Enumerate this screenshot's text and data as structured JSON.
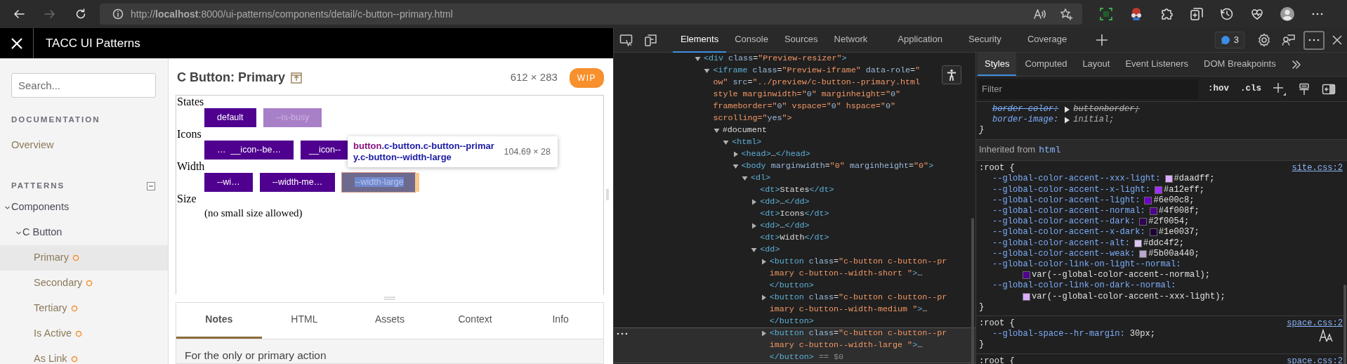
{
  "browser": {
    "url": "http://**localhost**:8000/ui-patterns/components/detail/c-button--primary.html",
    "back_disabled": false,
    "forward_disabled": true
  },
  "app": {
    "title": "TACC UI Patterns"
  },
  "sidebar": {
    "search_placeholder": "Search...",
    "documentation": {
      "heading": "DOCUMENTATION",
      "items": [
        {
          "label": "Overview"
        }
      ]
    },
    "patterns": {
      "heading": "PATTERNS",
      "tree": [
        {
          "label": "Components",
          "expanded": true,
          "children": [
            {
              "label": "C Button",
              "expanded": true,
              "children": [
                {
                  "label": "Primary",
                  "selected": true,
                  "wip": true
                },
                {
                  "label": "Secondary",
                  "selected": false,
                  "wip": true
                },
                {
                  "label": "Tertiary",
                  "selected": false,
                  "wip": true
                },
                {
                  "label": "Is Active",
                  "selected": false,
                  "wip": true
                },
                {
                  "label": "As Link",
                  "selected": false,
                  "wip": true
                }
              ]
            }
          ]
        }
      ]
    }
  },
  "preview": {
    "title": "C Button: Primary",
    "size": "612 × 283",
    "status": "WIP",
    "groups": [
      {
        "term": "States",
        "buttons": [
          {
            "label": "default",
            "busy": false,
            "inspected": false
          },
          {
            "label": "--is-busy",
            "busy": true,
            "inspected": false
          }
        ]
      },
      {
        "term": "Icons",
        "buttons": [
          {
            "label": "…  __icon--be…",
            "busy": false,
            "inspected": false
          },
          {
            "label": "__icon--",
            "busy": false,
            "inspected": false
          }
        ]
      },
      {
        "term": "Width",
        "buttons": [
          {
            "label": "--wi…",
            "busy": false,
            "inspected": false
          },
          {
            "label": "--width-me…",
            "busy": false,
            "inspected": false
          },
          {
            "label": "--width-large",
            "busy": false,
            "inspected": true
          }
        ]
      },
      {
        "term": "Size",
        "note": "(no small size allowed)"
      }
    ],
    "tooltip": {
      "tag": "button",
      "classes": ".c-button.c-button--primary.c-button--width-large",
      "size": "104.69 × 28"
    }
  },
  "panel": {
    "tabs": [
      {
        "label": "Notes",
        "selected": true
      },
      {
        "label": "HTML",
        "selected": false
      },
      {
        "label": "Assets",
        "selected": false
      },
      {
        "label": "Context",
        "selected": false
      },
      {
        "label": "Info",
        "selected": false
      }
    ],
    "notes": "For the only or primary action"
  },
  "devtools": {
    "tabs": [
      {
        "label": "Elements",
        "selected": true
      },
      {
        "label": "Console",
        "selected": false
      },
      {
        "label": "Sources",
        "selected": false
      },
      {
        "label": "Network",
        "selected": false
      },
      {
        "label": "Application",
        "selected": false
      },
      {
        "label": "Security",
        "selected": false
      },
      {
        "label": "Coverage",
        "selected": false
      }
    ],
    "issues": "3",
    "dom": [
      {
        "lines": [
          "<div class=\"Preview-resizer\">"
        ],
        "expanded": true,
        "selected": false,
        "children": [
          {
            "lines": [
              "<iframe class=\"Preview-iframe\" data-role=\"",
              "ow\" src=\"../preview/c-button--primary.html",
              "style marginwidth=\"0\" marginheight=\"0\"",
              "frameborder=\"0\" vspace=\"0\" hspace=\"0\"",
              "scrolling=\"yes\">"
            ],
            "expanded": true,
            "selected": false,
            "children": [
              {
                "lines": [
                  "#document"
                ],
                "expanded": true,
                "selected": false,
                "children": [
                  {
                    "lines": [
                      "<html>"
                    ],
                    "expanded": true,
                    "selected": false,
                    "children": [
                      {
                        "lines": [
                          "<head>…</head>"
                        ],
                        "expanded": false,
                        "selected": false
                      },
                      {
                        "lines": [
                          "<body marginwidth=\"0\" marginheight=\"0\">"
                        ],
                        "expanded": true,
                        "selected": false,
                        "children": [
                          {
                            "lines": [
                              "<dl>"
                            ],
                            "expanded": true,
                            "selected": false,
                            "children": [
                              {
                                "lines": [
                                  "<dt>States</dt>"
                                ],
                                "selected": false
                              },
                              {
                                "lines": [
                                  "<dd>…</dd>"
                                ],
                                "expanded": false,
                                "selected": false
                              },
                              {
                                "lines": [
                                  "<dt>Icons</dt>"
                                ],
                                "selected": false
                              },
                              {
                                "lines": [
                                  "<dd>…</dd>"
                                ],
                                "expanded": false,
                                "selected": false
                              },
                              {
                                "lines": [
                                  "<dt>Width</dt>"
                                ],
                                "selected": false
                              },
                              {
                                "lines": [
                                  "<dd>"
                                ],
                                "expanded": true,
                                "selected": false,
                                "children": [
                                  {
                                    "lines": [
                                      "<button class=\"c-button c-button--pr",
                                      "imary c-button--width-short \">…",
                                      "</button>"
                                    ],
                                    "expanded": false,
                                    "selected": false
                                  },
                                  {
                                    "lines": [
                                      "<button class=\"c-button c-button--pr",
                                      "imary c-button--width-medium \">…",
                                      "</button>"
                                    ],
                                    "expanded": false,
                                    "selected": false
                                  },
                                  {
                                    "lines": [
                                      "<button class=\"c-button c-button--pr",
                                      "imary c-button--width-large \">…",
                                      "</button>"
                                    ],
                                    "expanded": false,
                                    "selected": true,
                                    "marker": "== $0"
                                  }
                                ]
                              }
                            ]
                          }
                        ]
                      }
                    ]
                  }
                ]
              }
            ]
          }
        ]
      }
    ],
    "style_tabs": [
      {
        "label": "Styles",
        "selected": true
      },
      {
        "label": "Computed",
        "selected": false
      },
      {
        "label": "Layout",
        "selected": false
      },
      {
        "label": "Event Listeners",
        "selected": false
      },
      {
        "label": "DOM Breakpoints",
        "selected": false
      }
    ],
    "filter_placeholder": "Filter",
    "hov": ":hov",
    "cls": ".cls",
    "rules": [
      {
        "kind": "partial",
        "close": "}",
        "decls": [
          {
            "name": "border-color:",
            "value": "buttonborder;",
            "overridden": true,
            "expandable": true
          },
          {
            "name": "border-image:",
            "value": "initial;",
            "overridden": false,
            "expandable": true
          }
        ]
      },
      {
        "kind": "inherited",
        "label": "Inherited from",
        "source": "html"
      },
      {
        "kind": "rule",
        "selector": ":root {",
        "source": "site.css:2",
        "close": "}",
        "decls": [
          {
            "name": "--global-color-accent--xxx-light:",
            "value": "#daadff;",
            "color": "#daadff"
          },
          {
            "name": "--global-color-accent--x-light:",
            "value": "#a12eff;",
            "color": "#a12eff"
          },
          {
            "name": "--global-color-accent--light:",
            "value": "#6e00c8;",
            "color": "#6e00c8"
          },
          {
            "name": "--global-color-accent--normal:",
            "value": "#4f008f;",
            "color": "#4f008f"
          },
          {
            "name": "--global-color-accent--dark:",
            "value": "#2f0054;",
            "color": "#2f0054"
          },
          {
            "name": "--global-color-accent--x-dark:",
            "value": "#1e0037;",
            "color": "#1e0037"
          },
          {
            "name": "--global-color-accent--alt:",
            "value": "#ddc4f2;",
            "color": "#ddc4f2"
          },
          {
            "name": "--global-color-accent--weak:",
            "value": "#5b00a440;",
            "color": "#bba6cc"
          },
          {
            "name": "--global-color-link-on-light--normal:",
            "value": "var(--global-color-accent--normal);",
            "color": "#4f008f",
            "wrapped": true
          },
          {
            "name": "--global-color-link-on-dark--normal:",
            "value": "var(--global-color-accent--xxx-light);",
            "color": "#daadff",
            "wrapped": true
          }
        ]
      },
      {
        "kind": "rule",
        "selector": ":root {",
        "source": "space.css:2",
        "close": "}",
        "decls": [
          {
            "name": "--global-space--hr-margin:",
            "value": "30px;"
          }
        ]
      },
      {
        "kind": "rule",
        "selector": ":root {",
        "source": "space.css:2"
      }
    ]
  }
}
